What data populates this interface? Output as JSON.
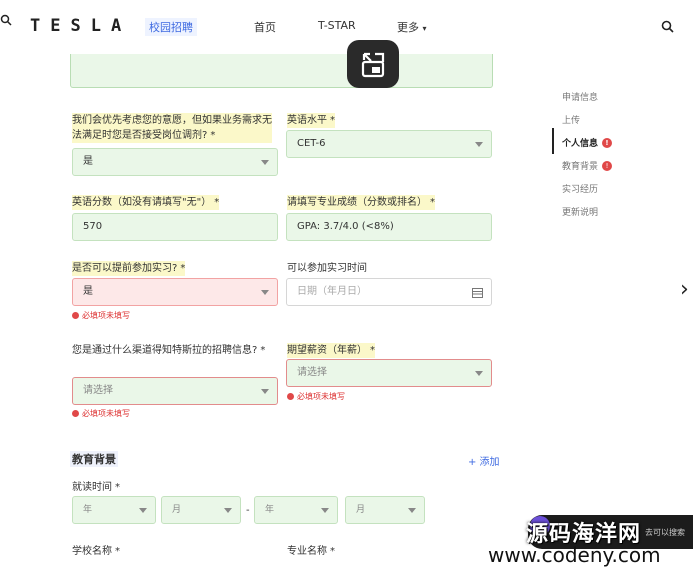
{
  "header": {
    "logo": "TESLA",
    "brand_tag": "校园招聘",
    "nav": [
      {
        "label": "首页"
      },
      {
        "label": "T-STAR"
      },
      {
        "label": "更多"
      }
    ]
  },
  "form": {
    "q_adjust": {
      "label": "我们会优先考虑您的意愿，但如果业务需求无法满足时您是否接受岗位调剂?",
      "req": "*",
      "value": "是"
    },
    "english_level": {
      "label": "英语水平",
      "req": "*",
      "value": "CET-6"
    },
    "english_score": {
      "label": "英语分数（如没有请填写\"无\"）",
      "req": "*",
      "value": "570"
    },
    "major_score": {
      "label": "请填写专业成绩（分数或排名）",
      "req": "*",
      "value": "GPA: 3.7/4.0 (<8%)"
    },
    "early_intern": {
      "label": "是否可以提前参加实习?",
      "req": "*",
      "value": "是",
      "error": "必填项未填写"
    },
    "intern_time": {
      "label": "可以参加实习时间",
      "placeholder": "日期（年月日）"
    },
    "source": {
      "label": "您是通过什么渠道得知特斯拉的招聘信息?",
      "req": "*",
      "placeholder": "请选择",
      "error": "必填项未填写"
    },
    "salary": {
      "label": "期望薪资（年薪）",
      "req": "*",
      "placeholder": "请选择",
      "error": "必填项未填写"
    },
    "education": {
      "title": "教育背景",
      "add_label": "+ 添加",
      "period_label": "就读时间",
      "req": "*",
      "year1": "年",
      "month1": "月",
      "dash": "-",
      "year2": "年",
      "month2": "月",
      "school_label": "学校名称",
      "major_label": "专业名称"
    }
  },
  "sidenav": {
    "items": [
      {
        "label": "申请信息"
      },
      {
        "label": "上传"
      },
      {
        "label": "个人信息",
        "badge": "!"
      },
      {
        "label": "教育背景",
        "badge": "!"
      },
      {
        "label": "实习经历"
      },
      {
        "label": "更新说明"
      }
    ]
  },
  "overlay": {
    "watermark_cn": "源码海洋网",
    "watermark_url": "www.codeny.com",
    "chip_text": "去可以搜索"
  }
}
